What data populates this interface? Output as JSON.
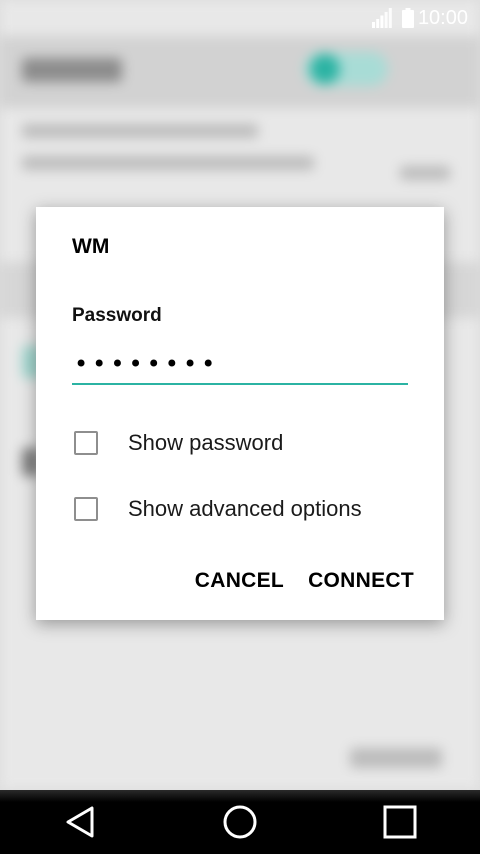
{
  "status_bar": {
    "time": "10:00",
    "icons": [
      "signal-icon",
      "battery-icon"
    ]
  },
  "dialog": {
    "title": "WM",
    "password_label": "Password",
    "password_value": "••••••••",
    "show_password_label": "Show password",
    "show_password_checked": false,
    "show_advanced_label": "Show advanced options",
    "show_advanced_checked": false,
    "cancel_label": "CANCEL",
    "connect_label": "CONNECT"
  },
  "nav_bar": {
    "icons": [
      "back-icon",
      "home-icon",
      "recents-icon"
    ]
  },
  "colors": {
    "accent": "#2bb3a3",
    "dialog_bg": "#ffffff",
    "checkbox_border": "#8e8e8e"
  }
}
